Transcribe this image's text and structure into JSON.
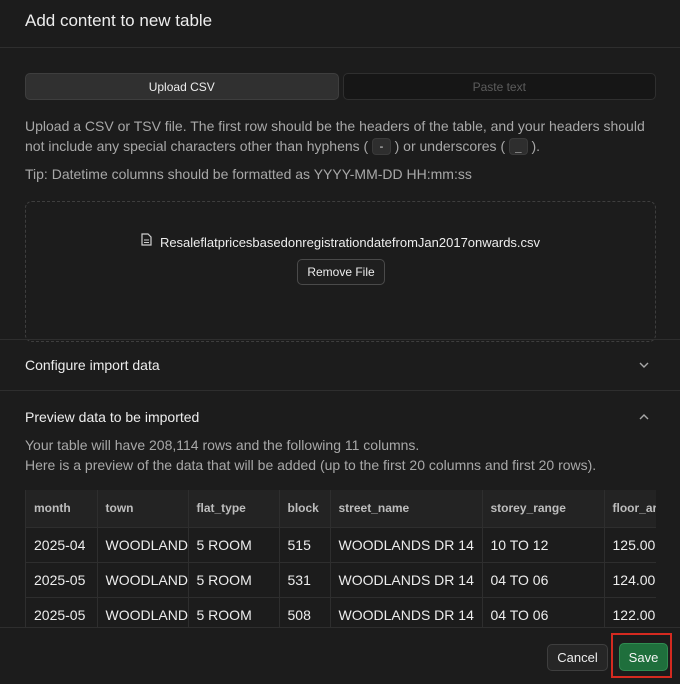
{
  "header": {
    "title": "Add content to new table"
  },
  "tabs": [
    {
      "label": "Upload CSV",
      "active": true
    },
    {
      "label": "Paste text",
      "active": false
    }
  ],
  "upload": {
    "description_part1": "Upload a CSV or TSV file. The first row should be the headers of the table, and your headers should not include any special characters other than hyphens (",
    "hyphen_code": "-",
    "description_part2": ") or underscores (",
    "underscore_code": "_",
    "description_part3": ").",
    "tip": "Tip: Datetime columns should be formatted as YYYY-MM-DD HH:mm:ss",
    "file_icon": "file-icon",
    "file_name": "ResaleflatpricesbasedonregistrationdatefromJan2017onwards.csv",
    "remove_label": "Remove File"
  },
  "configure": {
    "title": "Configure import data",
    "icon": "chevron-down-icon"
  },
  "preview": {
    "title": "Preview data to be imported",
    "icon": "chevron-up-icon",
    "summary": "Your table will have 208,114 rows and the following 11 columns.",
    "note": "Here is a preview of the data that will be added (up to the first 20 columns and first 20 rows).",
    "columns": [
      "month",
      "town",
      "flat_type",
      "block",
      "street_name",
      "storey_range",
      "floor_area"
    ],
    "rows": [
      [
        "2025-04",
        "WOODLANDS",
        "5 ROOM",
        "515",
        "WOODLANDS DR 14",
        "10 TO 12",
        "125.00"
      ],
      [
        "2025-05",
        "WOODLANDS",
        "5 ROOM",
        "531",
        "WOODLANDS DR 14",
        "04 TO 06",
        "124.00"
      ],
      [
        "2025-05",
        "WOODLANDS",
        "5 ROOM",
        "508",
        "WOODLANDS DR 14",
        "04 TO 06",
        "122.00"
      ]
    ]
  },
  "footer": {
    "cancel_label": "Cancel",
    "save_label": "Save"
  },
  "colors": {
    "accent": "#1f6f3c",
    "highlight": "#d52a20"
  }
}
